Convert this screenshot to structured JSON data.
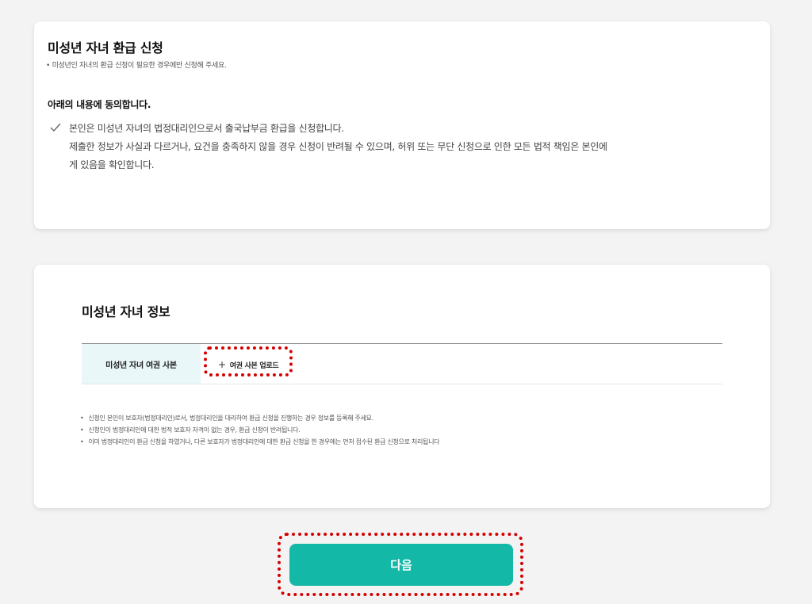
{
  "refund_card": {
    "title": "미성년 자녀 환급 신청",
    "subnote": "• 미성년인 자녀의 환급 신청이 필요한 경우에만 신청해 주세요.",
    "agree_heading": "아래의 내용에 동의합니다.",
    "agree_lines": [
      "본인은 미성년 자녀의 법정대리인으로서 출국납부금 환급을 신청합니다.",
      "제출한 정보가 사실과 다르거나, 요건을 충족하지 않을 경우 신청이 반려될 수 있으며, 허위 또는 무단 신청으로 인한 모든 법적 책임은 본인에",
      "게 있음을 확인합니다."
    ]
  },
  "info_card": {
    "title": "미성년 자녀 정보",
    "table_header": "미성년 자녀 여권 사본",
    "upload_label": "여권 사본 업로드",
    "upload_icon": "plus-icon",
    "notes": [
      "신청인 본인이 보호자(법정대리인)로서, 법정대리인을 대리하여 환급 신청을 진행하는 경우 정보를 등록해 주세요.",
      "신청인이 법정대리인에 대한 법적 보호자 자격이 없는 경우, 환급 신청이 반려됩니다.",
      "이미 법정대리인이 환급 신청을 하였거나, 다른 보호자가 법정대리인에 대한 환급 신청을 한 경우에는 먼저 접수된 환급 신청으로 처리됩니다"
    ]
  },
  "next_button": {
    "label": "다음"
  },
  "colors": {
    "accent": "#14b8a6",
    "header_cell_bg": "#e9f7f8",
    "highlight": "#d40000",
    "page_bg": "#f3f3f3"
  }
}
